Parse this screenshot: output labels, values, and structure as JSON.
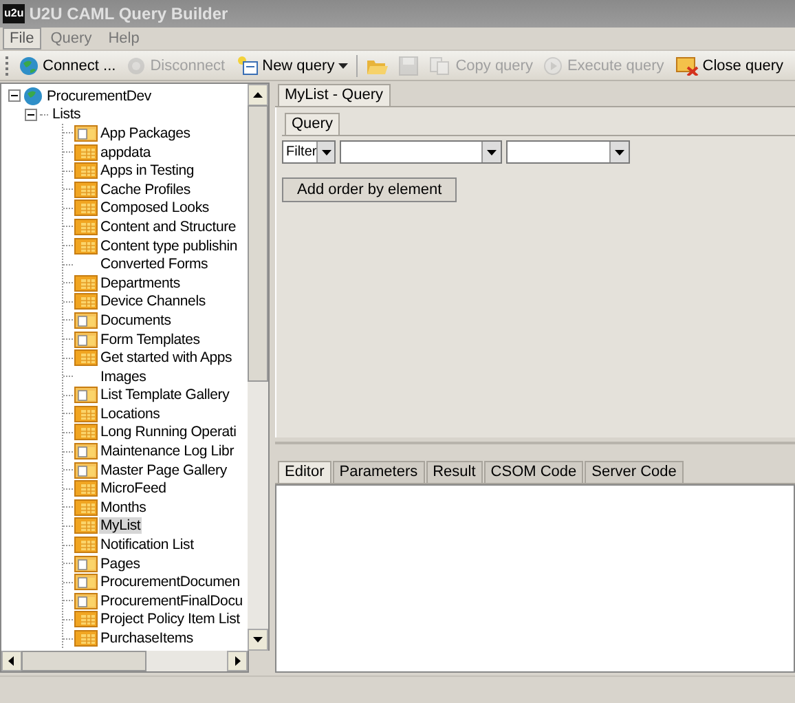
{
  "window": {
    "logo": "u2u",
    "title": "U2U CAML Query Builder"
  },
  "menu": [
    {
      "label": "File",
      "selected": true
    },
    {
      "label": "Query",
      "selected": false
    },
    {
      "label": "Help",
      "selected": false
    }
  ],
  "toolbar": [
    {
      "kind": "button",
      "label": "Connect ...",
      "disabled": false
    },
    {
      "kind": "button",
      "label": "Disconnect",
      "disabled": true
    },
    {
      "kind": "dropdown",
      "label": "New query",
      "disabled": false
    },
    {
      "kind": "icon",
      "disabled": false
    },
    {
      "kind": "icon",
      "disabled": true
    },
    {
      "kind": "button",
      "label": "Copy query",
      "disabled": true
    },
    {
      "kind": "button",
      "label": "Execute query",
      "disabled": true
    },
    {
      "kind": "button",
      "label": "Close query",
      "disabled": false
    }
  ],
  "tree": [
    {
      "label": "ProcurementDev",
      "kind": "site",
      "expanded": true,
      "selected": false,
      "children": [
        {
          "label": "Lists",
          "kind": "folder",
          "expanded": true,
          "selected": false,
          "children": [
            {
              "label": "App Packages",
              "kind": "library",
              "selected": false
            },
            {
              "label": "appdata",
              "kind": "list",
              "selected": false
            },
            {
              "label": "Apps in Testing",
              "kind": "list",
              "selected": false
            },
            {
              "label": "Cache Profiles",
              "kind": "list",
              "selected": false
            },
            {
              "label": "Composed Looks",
              "kind": "list",
              "selected": false
            },
            {
              "label": "Content and Structure",
              "kind": "list",
              "selected": false
            },
            {
              "label": "Content type publishin",
              "kind": "list",
              "selected": false
            },
            {
              "label": "Converted Forms",
              "kind": "plain",
              "selected": false
            },
            {
              "label": "Departments",
              "kind": "list",
              "selected": false
            },
            {
              "label": "Device Channels",
              "kind": "list",
              "selected": false
            },
            {
              "label": "Documents",
              "kind": "library",
              "selected": false
            },
            {
              "label": "Form Templates",
              "kind": "library",
              "selected": false
            },
            {
              "label": "Get started with Apps",
              "kind": "list",
              "selected": false
            },
            {
              "label": "Images",
              "kind": "plain",
              "selected": false
            },
            {
              "label": "List Template Gallery",
              "kind": "library",
              "selected": false
            },
            {
              "label": "Locations",
              "kind": "list",
              "selected": false
            },
            {
              "label": "Long Running Operati",
              "kind": "list",
              "selected": false
            },
            {
              "label": "Maintenance Log Libr",
              "kind": "library",
              "selected": false
            },
            {
              "label": "Master Page Gallery",
              "kind": "library",
              "selected": false
            },
            {
              "label": "MicroFeed",
              "kind": "list",
              "selected": false
            },
            {
              "label": "Months",
              "kind": "list",
              "selected": false
            },
            {
              "label": "MyList",
              "kind": "list",
              "selected": true
            },
            {
              "label": "Notification List",
              "kind": "list",
              "selected": false
            },
            {
              "label": "Pages",
              "kind": "library",
              "selected": false
            },
            {
              "label": "ProcurementDocumen",
              "kind": "library",
              "selected": false
            },
            {
              "label": "ProcurementFinalDocu",
              "kind": "library",
              "selected": false
            },
            {
              "label": "Project Policy Item List",
              "kind": "list",
              "selected": false
            },
            {
              "label": "PurchaseItems",
              "kind": "list",
              "selected": false
            }
          ]
        }
      ]
    }
  ],
  "document_tabs": [
    {
      "label": "MyList - Query",
      "selected": true
    }
  ],
  "query_tabs": [
    {
      "label": "Query",
      "selected": true
    }
  ],
  "filter_row": {
    "type_select": "Filter"
  },
  "order_button": "Add order by element",
  "bottom_tabs": [
    {
      "label": "Editor",
      "selected": true
    },
    {
      "label": "Parameters",
      "selected": false
    },
    {
      "label": "Result",
      "selected": false
    },
    {
      "label": "CSOM Code",
      "selected": false
    },
    {
      "label": "Server Code",
      "selected": false
    }
  ]
}
